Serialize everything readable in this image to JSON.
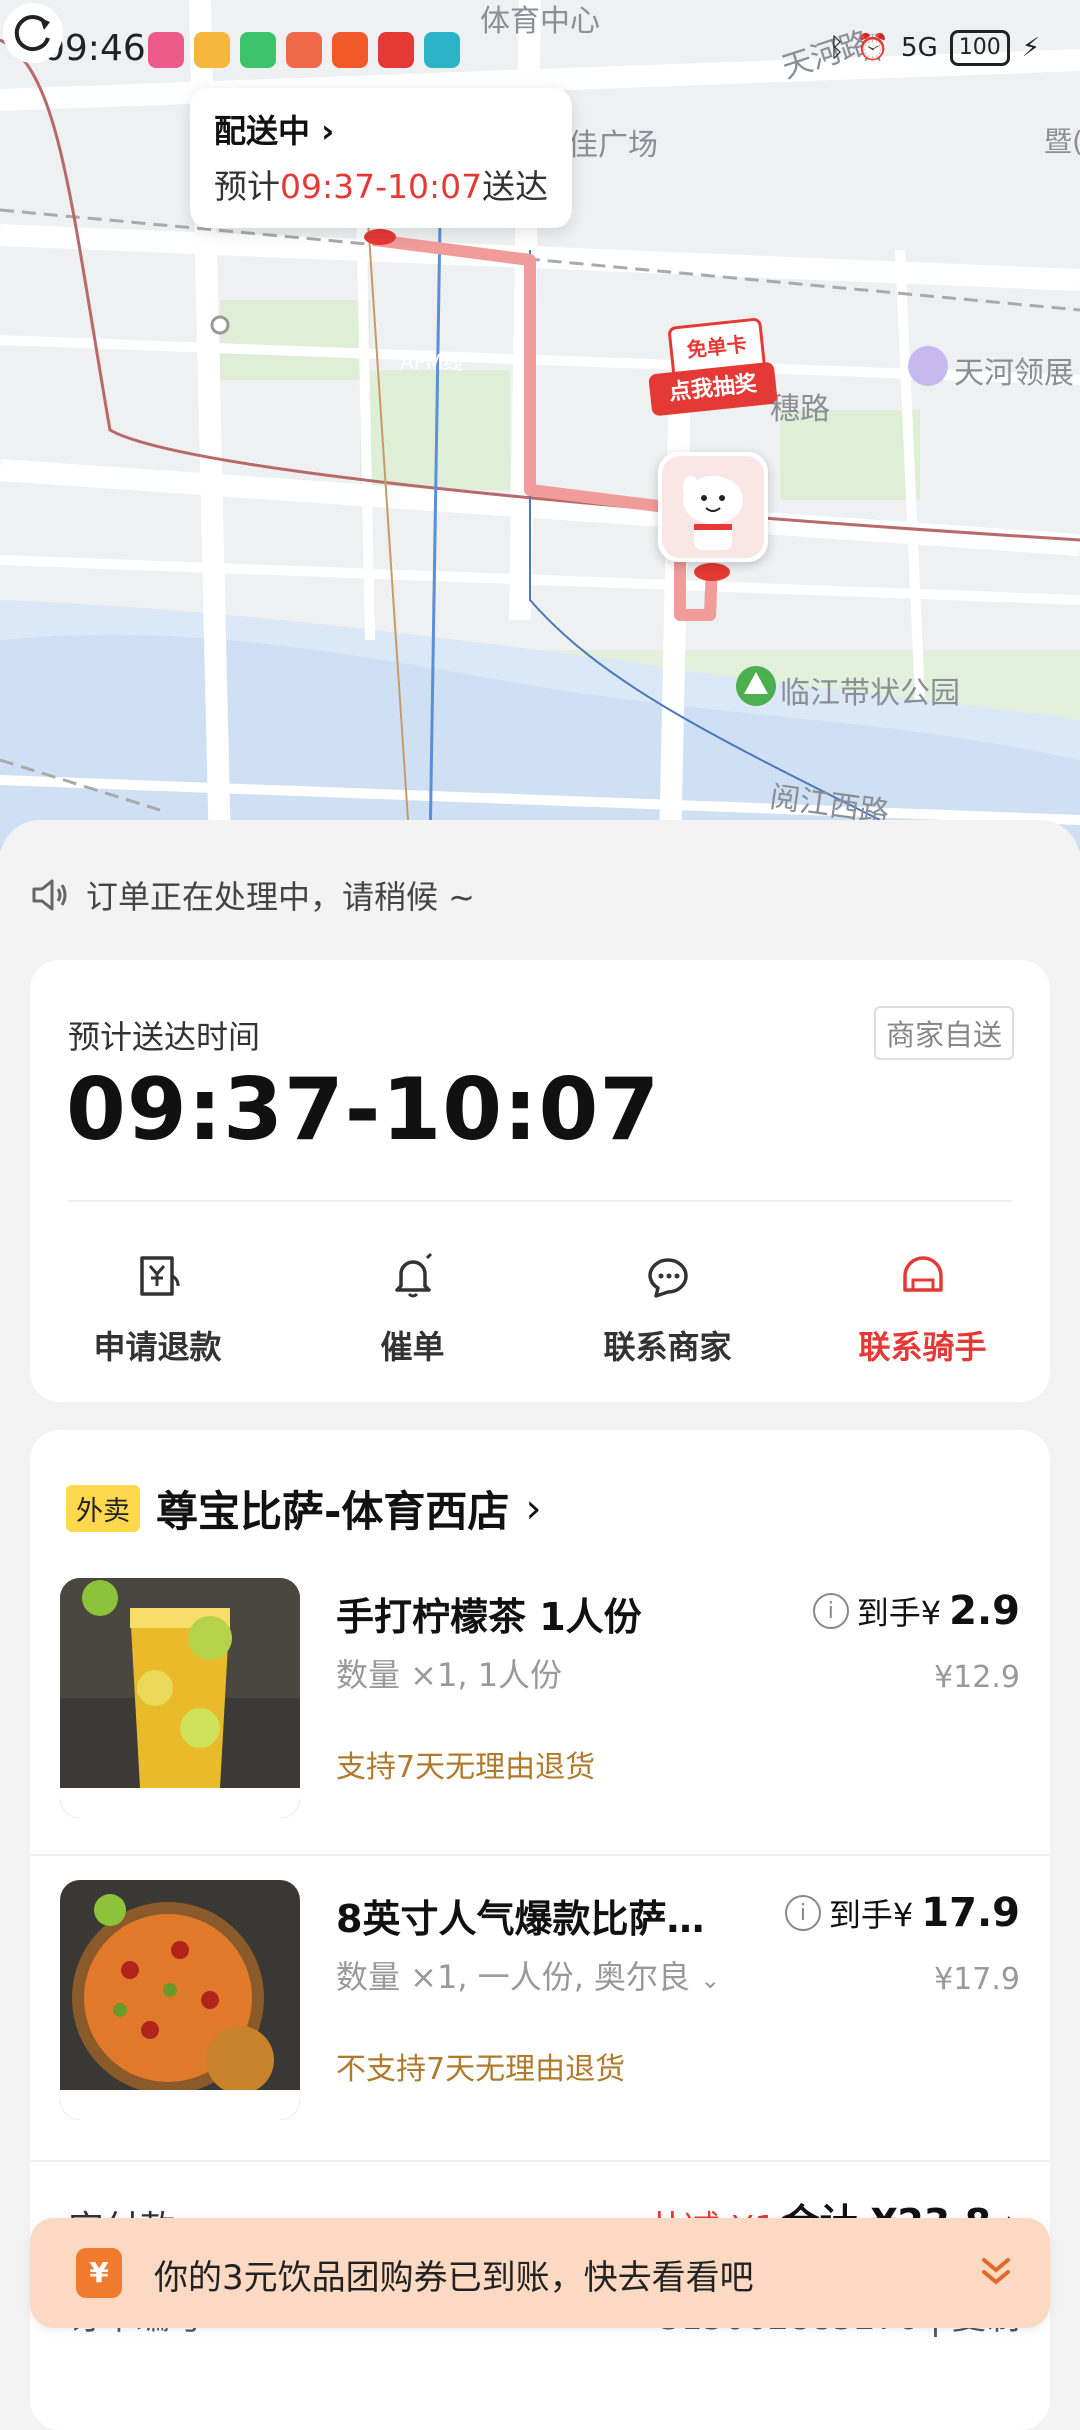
{
  "status_bar": {
    "time": "09:46",
    "battery": "100",
    "network": "5G"
  },
  "map": {
    "labels": {
      "sports_center": "体育中心",
      "plaza": "佳广场",
      "tianhe_ling": "天河领展",
      "huide_road": "穗路",
      "apm_line": "APM线",
      "linjiang_park": "临江带状公园",
      "yuejiang_west": "阅江西路",
      "tianhe_road": "天河路",
      "ji_stone": "暨(石"
    },
    "delivery_status": "配送中",
    "eta_prefix": "预计",
    "eta_time": "09:37-10:07",
    "eta_suffix": "送达",
    "lottery_top": "免单卡",
    "lottery_bottom": "点我抽奖"
  },
  "notice": "订单正在处理中，请稍候 ~",
  "eta_card": {
    "title": "预计送达时间",
    "tag": "商家自送",
    "time": "09:37-10:07",
    "actions": [
      {
        "label": "申请退款",
        "icon": "refund-icon"
      },
      {
        "label": "催单",
        "icon": "bell-icon"
      },
      {
        "label": "联系商家",
        "icon": "chat-icon"
      },
      {
        "label": "联系骑手",
        "icon": "helmet-icon"
      }
    ]
  },
  "order": {
    "badge": "外卖",
    "store": "尊宝比萨-体育西店",
    "items": [
      {
        "title": "手打柠檬茶 1人份",
        "spec": "数量 ×1, 1人份",
        "policy": "支持7天无理由退货",
        "price_prefix": "到手¥",
        "price": "2.9",
        "original": "¥12.9"
      },
      {
        "title": "8英寸人气爆款比萨…",
        "spec": "数量 ×1, 一人份, 奥尔良",
        "policy": "不支持7天无理由退货",
        "price_prefix": "到手¥",
        "price": "17.9",
        "original": "¥17.9"
      }
    ],
    "pay_label": "实付款",
    "discount": "共减 ¥10",
    "total": "合计 ¥23.8",
    "order_label": "订单编号",
    "order_no": "315062885276",
    "copy": "复制"
  },
  "toast": {
    "message": "你的3元饮品团购券已到账，快去看看吧",
    "icon_glyph": "¥"
  },
  "colors": {
    "accent_red": "#e53935",
    "policy_brown": "#b07a2c",
    "badge_yellow": "#ffd84d"
  }
}
